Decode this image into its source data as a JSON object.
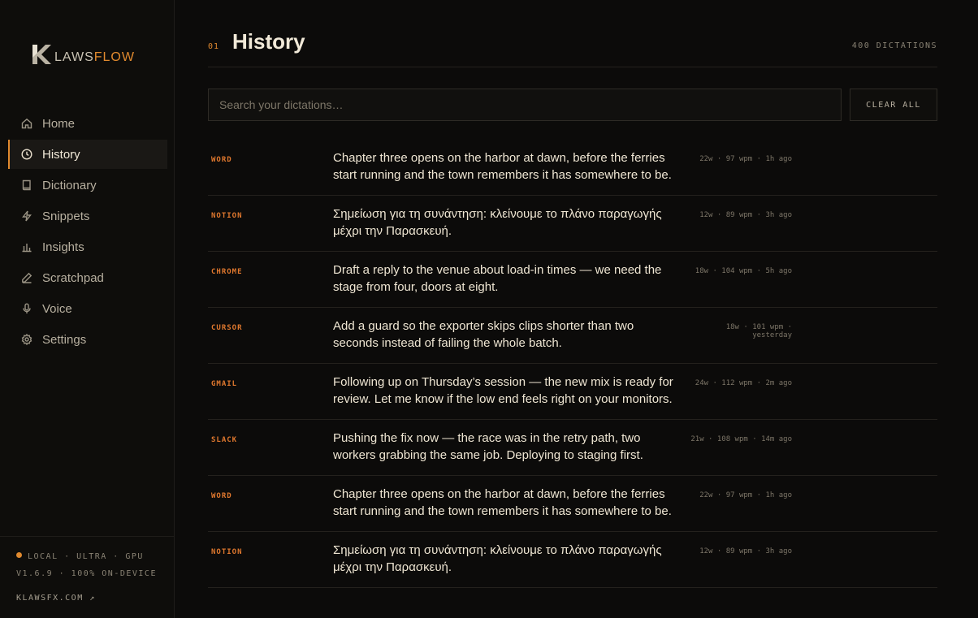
{
  "brand": {
    "word_a": "LAWS",
    "word_b": "FLOW",
    "accent": "#e0892e"
  },
  "nav": [
    {
      "label": "Home",
      "icon": "home-icon"
    },
    {
      "label": "History",
      "icon": "clock-icon",
      "active": true
    },
    {
      "label": "Dictionary",
      "icon": "book-icon"
    },
    {
      "label": "Snippets",
      "icon": "bolt-icon"
    },
    {
      "label": "Insights",
      "icon": "bar-chart-icon"
    },
    {
      "label": "Scratchpad",
      "icon": "pen-icon"
    },
    {
      "label": "Voice",
      "icon": "mic-icon"
    },
    {
      "label": "Settings",
      "icon": "gear-icon"
    }
  ],
  "footer": {
    "status": "LOCAL · ULTRA · GPU",
    "version": "V1.6.9 · 100% ON-DEVICE",
    "site": "KLAWSFX.COM ↗"
  },
  "header": {
    "num": "01",
    "title": "History",
    "count": "400 DICTATIONS"
  },
  "search": {
    "placeholder": "Search your dictations…",
    "clear_label": "CLEAR ALL"
  },
  "entries": [
    {
      "app": "WORD",
      "text": "Chapter three opens on the harbor at dawn, before the ferries start running and the town remembers it has somewhere to be.",
      "meta": "22w · 97 wpm · 1h ago"
    },
    {
      "app": "NOTION",
      "text": "Σημείωση για τη συνάντηση: κλείνουμε το πλάνο παραγωγής μέχρι την Παρασκευή.",
      "meta": "12w · 89 wpm · 3h ago"
    },
    {
      "app": "CHROME",
      "text": "Draft a reply to the venue about load-in times — we need the stage from four, doors at eight.",
      "meta": "18w · 104 wpm · 5h ago"
    },
    {
      "app": "CURSOR",
      "text": "Add a guard so the exporter skips clips shorter than two seconds instead of failing the whole batch.",
      "meta": "18w · 101 wpm · yesterday"
    },
    {
      "app": "GMAIL",
      "text": "Following up on Thursday’s session — the new mix is ready for review. Let me know if the low end feels right on your monitors.",
      "meta": "24w · 112 wpm · 2m ago"
    },
    {
      "app": "SLACK",
      "text": "Pushing the fix now — the race was in the retry path, two workers grabbing the same job. Deploying to staging first.",
      "meta": "21w · 108 wpm · 14m ago"
    },
    {
      "app": "WORD",
      "text": "Chapter three opens on the harbor at dawn, before the ferries start running and the town remembers it has somewhere to be.",
      "meta": "22w · 97 wpm · 1h ago"
    },
    {
      "app": "NOTION",
      "text": "Σημείωση για τη συνάντηση: κλείνουμε το πλάνο παραγωγής μέχρι την Παρασκευή.",
      "meta": "12w · 89 wpm · 3h ago"
    }
  ]
}
